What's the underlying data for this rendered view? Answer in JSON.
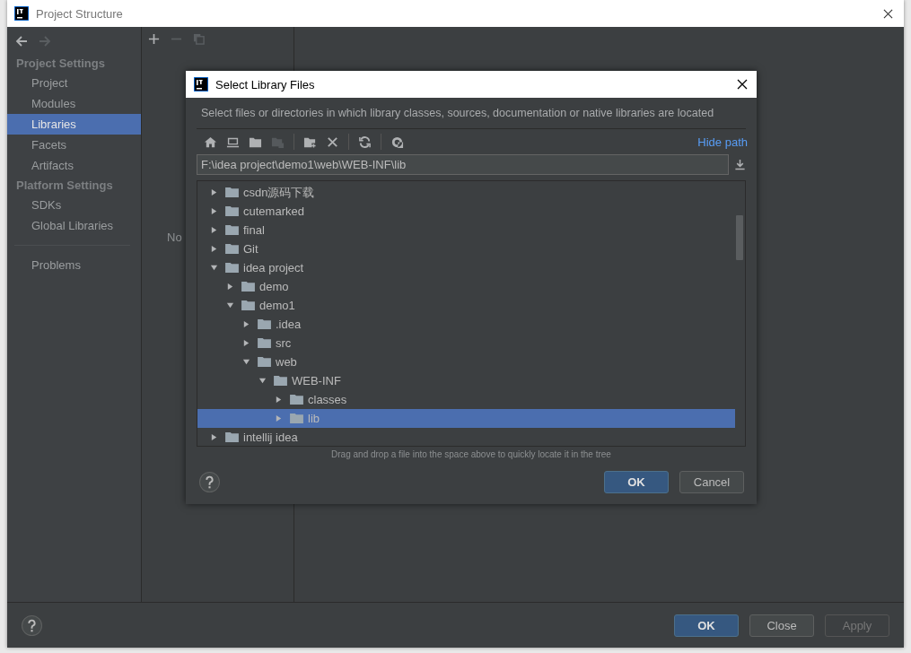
{
  "window": {
    "title": "Project Structure"
  },
  "nav_buttons": [
    {
      "kind": "back",
      "disabled": false
    },
    {
      "kind": "forward",
      "disabled": true
    }
  ],
  "sidebar": {
    "sections": [
      {
        "heading": "Project Settings",
        "items": [
          {
            "label": "Project",
            "selected": false
          },
          {
            "label": "Modules",
            "selected": false
          },
          {
            "label": "Libraries",
            "selected": true
          },
          {
            "label": "Facets",
            "selected": false
          },
          {
            "label": "Artifacts",
            "selected": false
          }
        ]
      },
      {
        "heading": "Platform Settings",
        "items": [
          {
            "label": "SDKs",
            "selected": false
          },
          {
            "label": "Global Libraries",
            "selected": false
          }
        ]
      }
    ],
    "bottom_items": [
      {
        "label": "Problems",
        "selected": false
      }
    ]
  },
  "library_toolbar": [
    {
      "kind": "add",
      "disabled": false
    },
    {
      "kind": "remove",
      "disabled": true
    },
    {
      "kind": "copy",
      "disabled": true
    }
  ],
  "library_panel": {
    "empty_text": "No"
  },
  "dialog": {
    "title": "Select Library Files",
    "description": "Select files or directories in which library classes, sources, documentation or native libraries are located",
    "toolbar": [
      [
        {
          "kind": "home",
          "disabled": false
        },
        {
          "kind": "desktop",
          "disabled": false
        },
        {
          "kind": "project",
          "disabled": false
        },
        {
          "kind": "module",
          "disabled": true
        }
      ],
      [
        {
          "kind": "new-folder",
          "disabled": false
        },
        {
          "kind": "delete",
          "disabled": false
        }
      ],
      [
        {
          "kind": "refresh",
          "disabled": false
        }
      ],
      [
        {
          "kind": "hidden",
          "disabled": false
        }
      ]
    ],
    "hide_path": "Hide path",
    "path": "F:\\idea project\\demo1\\web\\WEB-INF\\lib",
    "tree": [
      {
        "label": "csdn源码下载",
        "expanded": false,
        "selected": false
      },
      {
        "label": "cutemarked",
        "expanded": false,
        "selected": false
      },
      {
        "label": "final",
        "expanded": false,
        "selected": false
      },
      {
        "label": "Git",
        "expanded": false,
        "selected": false
      },
      {
        "label": "idea project",
        "expanded": true,
        "selected": false,
        "children": [
          {
            "label": "demo",
            "expanded": false,
            "selected": false
          },
          {
            "label": "demo1",
            "expanded": true,
            "selected": false,
            "children": [
              {
                "label": ".idea",
                "expanded": false,
                "selected": false
              },
              {
                "label": "src",
                "expanded": false,
                "selected": false
              },
              {
                "label": "web",
                "expanded": true,
                "selected": false,
                "children": [
                  {
                    "label": "WEB-INF",
                    "expanded": true,
                    "selected": false,
                    "children": [
                      {
                        "label": "classes",
                        "expanded": false,
                        "selected": false
                      },
                      {
                        "label": "lib",
                        "expanded": false,
                        "selected": true
                      }
                    ]
                  }
                ]
              }
            ]
          }
        ]
      },
      {
        "label": "intellij idea",
        "expanded": false,
        "selected": false
      }
    ],
    "hint": "Drag and drop a file into the space above to quickly locate it in the tree",
    "buttons": [
      {
        "label": "OK",
        "kind": "primary",
        "disabled": false
      },
      {
        "label": "Cancel",
        "kind": "secondary",
        "disabled": false
      }
    ]
  },
  "footer_buttons": [
    {
      "label": "OK",
      "kind": "primary",
      "disabled": false
    },
    {
      "label": "Close",
      "kind": "secondary",
      "disabled": false
    },
    {
      "label": "Apply",
      "kind": "secondary",
      "disabled": true
    }
  ]
}
